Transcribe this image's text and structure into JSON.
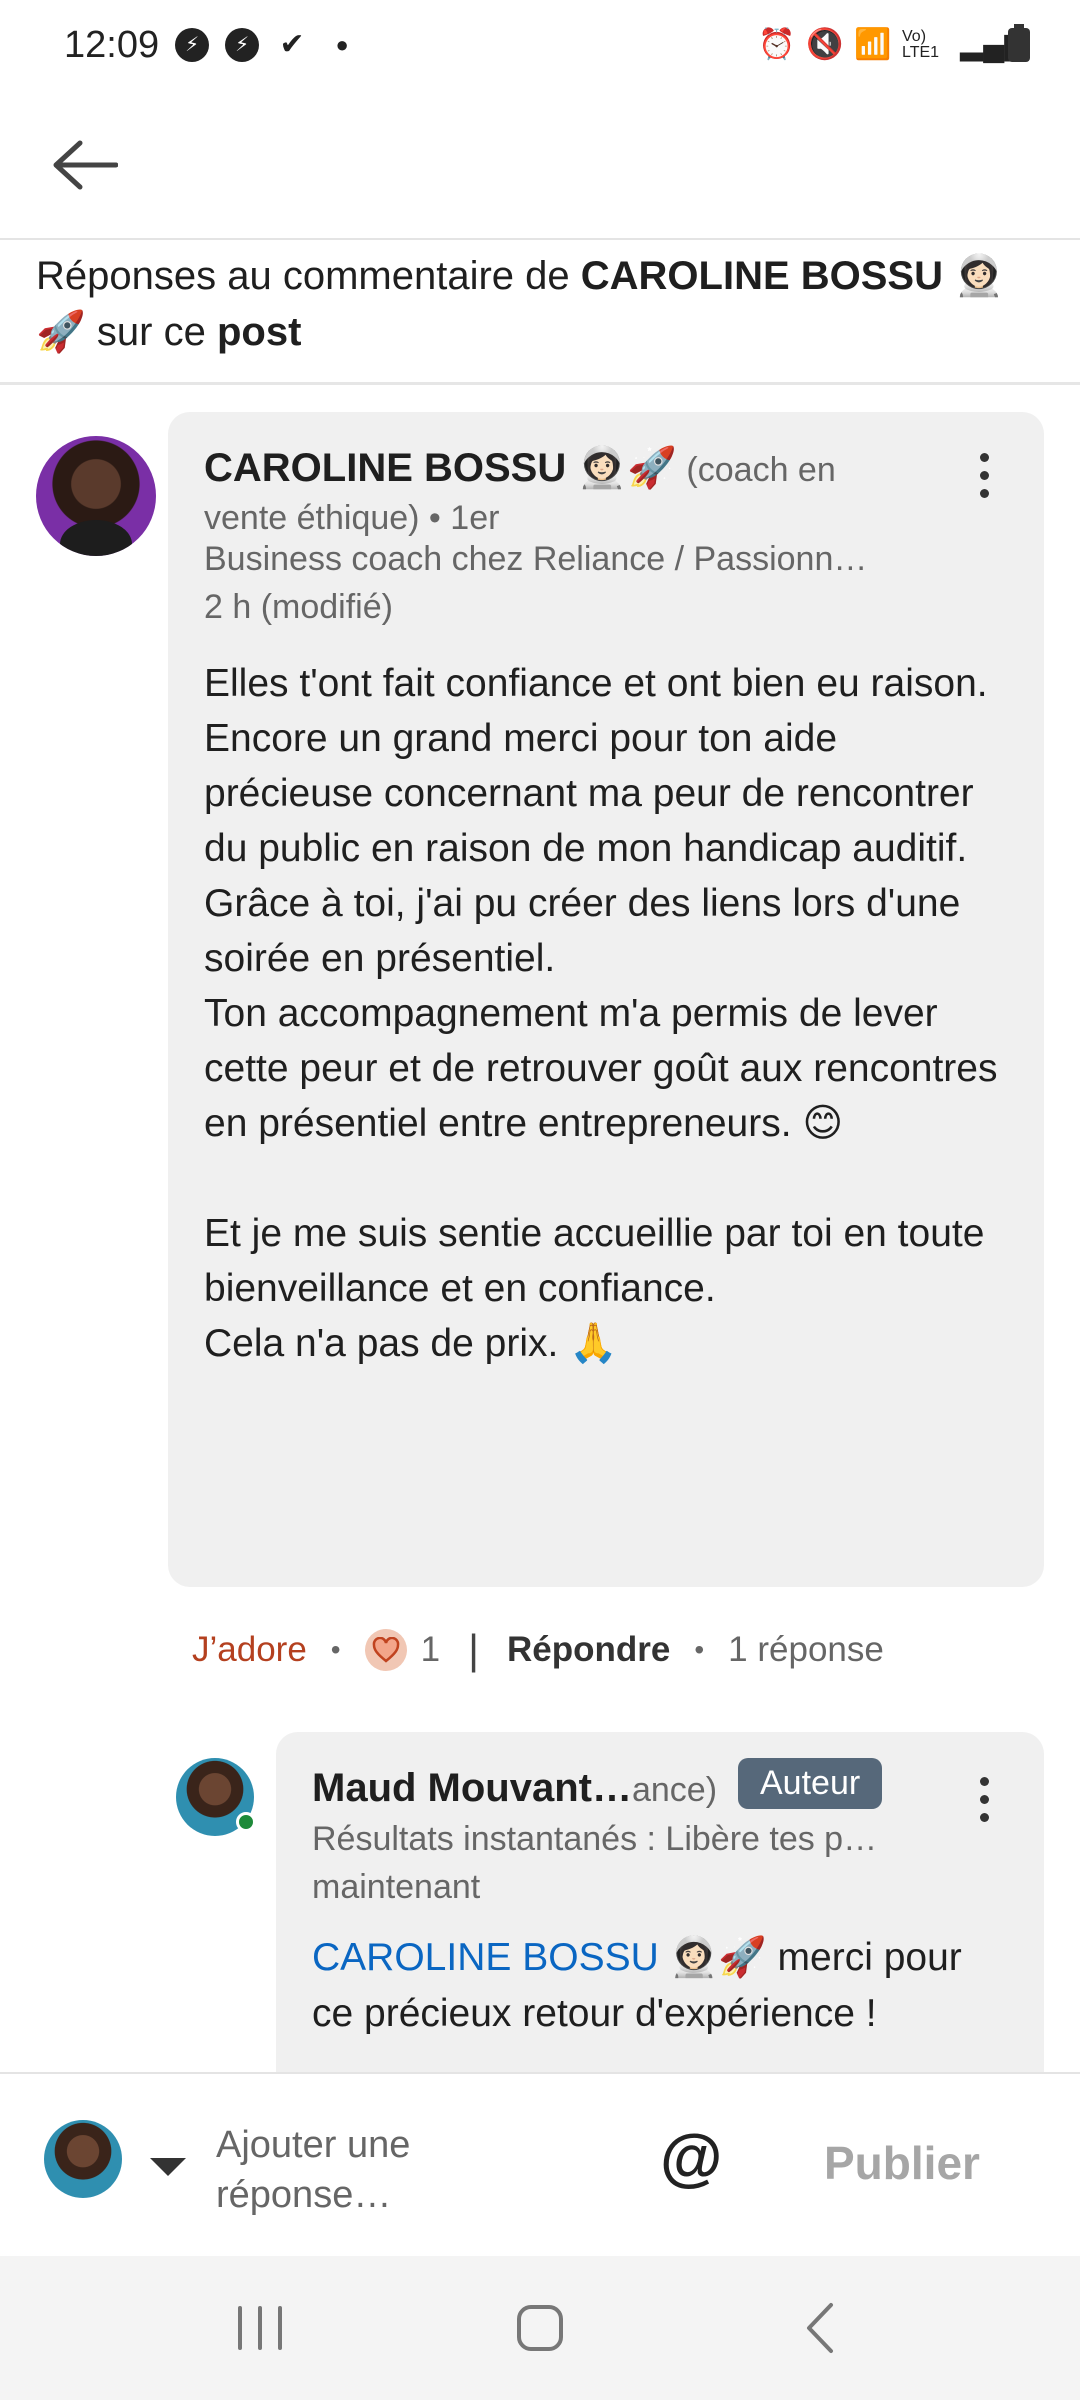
{
  "status_bar": {
    "time": "12:09",
    "notification_icons": [
      "messenger-icon",
      "messenger-icon",
      "check-icon",
      "dot-icon"
    ],
    "system_icons": [
      "alarm-icon",
      "mute-icon",
      "wifi-icon",
      "volte-icon",
      "signal-icon",
      "battery-icon"
    ],
    "volte_label": "Vo) LTE1"
  },
  "appbar": {
    "back_icon": "arrow-left-icon"
  },
  "header": {
    "prefix": "Réponses au commentaire de ",
    "author": "CAROLINE BOSSU",
    "emoji": "👩🏻‍🚀 🚀",
    "middle": " sur ce ",
    "post_word": "post"
  },
  "comment": {
    "author_name": "CAROLINE BOSSU 👩🏻‍🚀🚀",
    "author_headline_inline": "(coach en vente éthique) • 1er",
    "headline": "Business coach chez Reliance / Passionn…",
    "time": "2 h (modifié)",
    "body": "Elles t'ont fait confiance et ont bien eu raison.\nEncore un grand merci pour ton aide précieuse concernant ma peur de rencontrer du public en raison de mon handicap auditif.\nGrâce à toi, j'ai pu créer des liens lors d'une soirée en présentiel.\nTon accompagnement m'a permis de lever cette peur et de retrouver goût aux rencontres en présentiel entre entrepreneurs. 😊\n\nEt je me suis sentie accueillie par toi en toute bienveillance et en confiance.\nCela n'a pas de prix. 🙏"
  },
  "actions": {
    "like_label": "J’adore",
    "reaction_count": "1",
    "reply_label": "Répondre",
    "replies_count": "1 réponse"
  },
  "reply": {
    "author_name": "Maud Mouvant…",
    "author_name_rest": "ance)",
    "badge": "Auteur",
    "headline": "Résultats instantanés : Libère tes p…",
    "time": "maintenant",
    "mention": "CAROLINE BOSSU 👩🏻‍🚀🚀",
    "body": " merci pour ce précieux retour d'expérience !"
  },
  "composer": {
    "placeholder": "Ajouter une réponse…",
    "at_symbol": "@",
    "publish_label": "Publier"
  },
  "colors": {
    "like": "#b4401f",
    "mention": "#0a66c2",
    "badge": "#56687a",
    "bubble": "#f0f0f0"
  }
}
